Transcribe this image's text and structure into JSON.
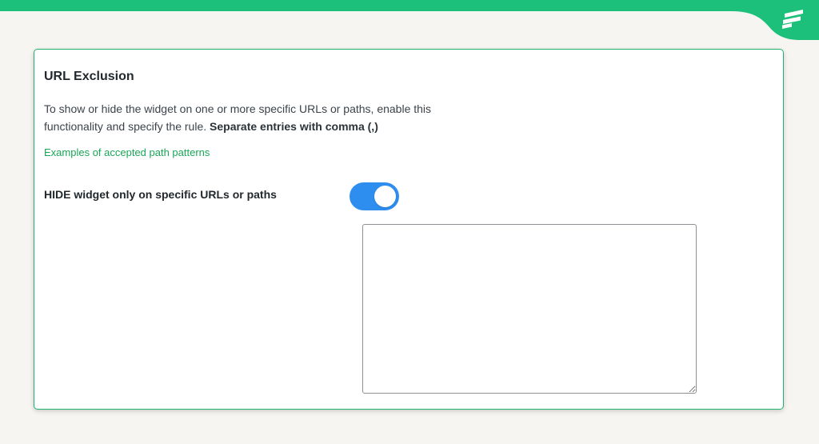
{
  "colors": {
    "brand_green": "#1cc07a",
    "card_border": "#21b36e",
    "link_green": "#1aa657",
    "toggle_on": "#2d8ef0",
    "page_background": "#f6f5f1"
  },
  "brand": {
    "logo_icon": "brand-stripes-logo-icon"
  },
  "settings": {
    "title": "URL Exclusion",
    "description": "To show or hide the widget on one or more specific URLs or paths, enable this functionality and specify the rule. ",
    "description_bold": "Separate entries with comma (,)",
    "examples_link": "Examples of accepted path patterns",
    "hide_label": "HIDE widget only on specific URLs or paths",
    "hide_toggle_on": true,
    "url_textarea_value": ""
  }
}
